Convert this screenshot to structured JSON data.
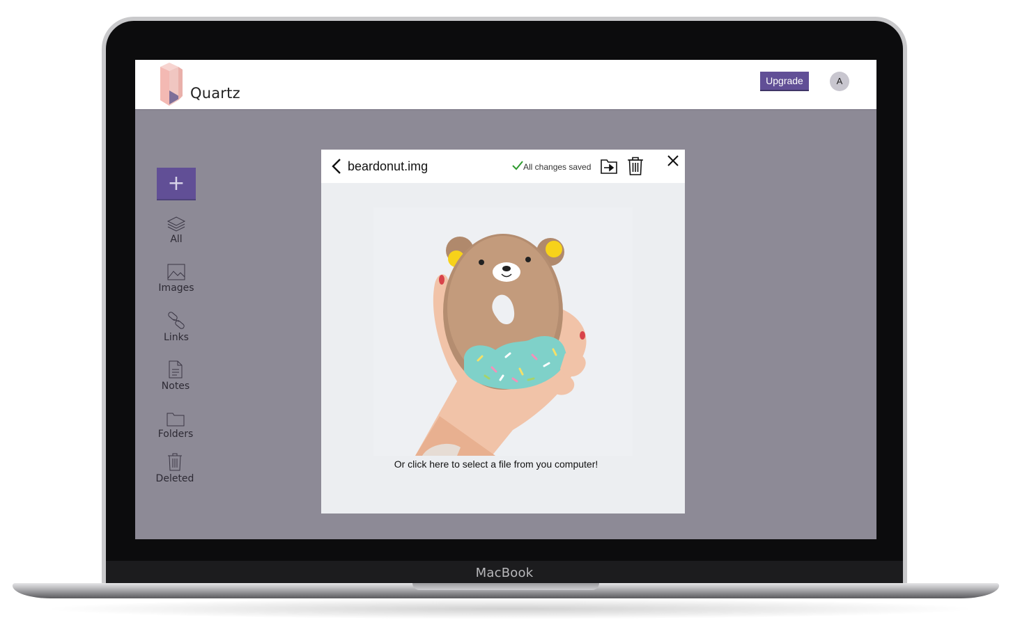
{
  "device": {
    "brand": "MacBook"
  },
  "app": {
    "name": "Quartz",
    "logo": "quartz-crystal-logo",
    "upgrade_label": "Upgrade",
    "avatar_initial": "A",
    "accent": "#614f96"
  },
  "sidebar": {
    "add_label": "+",
    "items": [
      {
        "label": "All",
        "icon": "layers-icon"
      },
      {
        "label": "Images",
        "icon": "image-icon"
      },
      {
        "label": "Links",
        "icon": "link-icon"
      },
      {
        "label": "Notes",
        "icon": "note-icon"
      },
      {
        "label": "Folders",
        "icon": "folder-icon"
      },
      {
        "label": "Deleted",
        "icon": "trash-icon"
      }
    ]
  },
  "modal": {
    "file_name": "beardonut.img",
    "status": "All changes saved",
    "image": "bear-donut-photo",
    "upload_hint": "Or click here to select a file from you computer!",
    "icons": [
      "back-icon",
      "check-icon",
      "move-to-folder-icon",
      "trash-icon",
      "close-icon"
    ]
  }
}
